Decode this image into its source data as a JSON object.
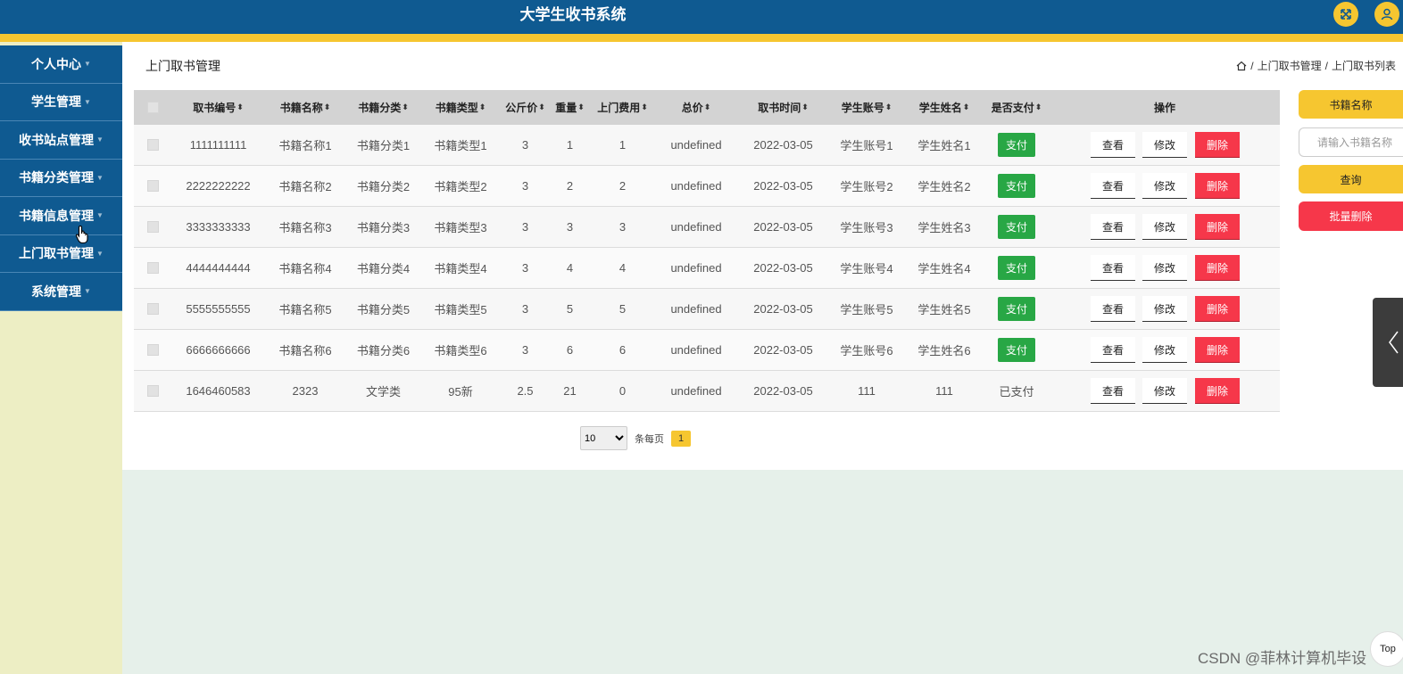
{
  "header": {
    "title": "大学生收书系统",
    "accent": "#f6c630",
    "bg": "#0f5a91"
  },
  "sidebar": {
    "items": [
      {
        "label": "个人中心"
      },
      {
        "label": "学生管理"
      },
      {
        "label": "收书站点管理"
      },
      {
        "label": "书籍分类管理"
      },
      {
        "label": "书籍信息管理"
      },
      {
        "label": "上门取书管理"
      },
      {
        "label": "系统管理"
      }
    ]
  },
  "page": {
    "title": "上门取书管理",
    "breadcrumb": [
      "上门取书管理",
      "上门取书列表"
    ]
  },
  "table": {
    "headers": [
      "取书编号",
      "书籍名称",
      "书籍分类",
      "书籍类型",
      "公斤价",
      "重量",
      "上门费用",
      "总价",
      "取书时间",
      "学生账号",
      "学生姓名",
      "是否支付",
      "操作"
    ],
    "rows": [
      {
        "id": "1111111111",
        "name": "书籍名称1",
        "cat": "书籍分类1",
        "type": "书籍类型1",
        "price": "3",
        "weight": "1",
        "fee": "1",
        "total": "undefined",
        "time": "2022-03-05",
        "account": "学生账号1",
        "student": "学生姓名1",
        "paid": "支付",
        "paid_is_button": true
      },
      {
        "id": "2222222222",
        "name": "书籍名称2",
        "cat": "书籍分类2",
        "type": "书籍类型2",
        "price": "3",
        "weight": "2",
        "fee": "2",
        "total": "undefined",
        "time": "2022-03-05",
        "account": "学生账号2",
        "student": "学生姓名2",
        "paid": "支付",
        "paid_is_button": true
      },
      {
        "id": "3333333333",
        "name": "书籍名称3",
        "cat": "书籍分类3",
        "type": "书籍类型3",
        "price": "3",
        "weight": "3",
        "fee": "3",
        "total": "undefined",
        "time": "2022-03-05",
        "account": "学生账号3",
        "student": "学生姓名3",
        "paid": "支付",
        "paid_is_button": true
      },
      {
        "id": "4444444444",
        "name": "书籍名称4",
        "cat": "书籍分类4",
        "type": "书籍类型4",
        "price": "3",
        "weight": "4",
        "fee": "4",
        "total": "undefined",
        "time": "2022-03-05",
        "account": "学生账号4",
        "student": "学生姓名4",
        "paid": "支付",
        "paid_is_button": true
      },
      {
        "id": "5555555555",
        "name": "书籍名称5",
        "cat": "书籍分类5",
        "type": "书籍类型5",
        "price": "3",
        "weight": "5",
        "fee": "5",
        "total": "undefined",
        "time": "2022-03-05",
        "account": "学生账号5",
        "student": "学生姓名5",
        "paid": "支付",
        "paid_is_button": true
      },
      {
        "id": "6666666666",
        "name": "书籍名称6",
        "cat": "书籍分类6",
        "type": "书籍类型6",
        "price": "3",
        "weight": "6",
        "fee": "6",
        "total": "undefined",
        "time": "2022-03-05",
        "account": "学生账号6",
        "student": "学生姓名6",
        "paid": "支付",
        "paid_is_button": true
      },
      {
        "id": "1646460583",
        "name": "2323",
        "cat": "文学类",
        "type": "95新",
        "price": "2.5",
        "weight": "21",
        "fee": "0",
        "total": "undefined",
        "time": "2022-03-05",
        "account": "111",
        "student": "111",
        "paid": "已支付",
        "paid_is_button": false
      }
    ],
    "actions": {
      "view": "查看",
      "edit": "修改",
      "delete": "删除"
    }
  },
  "pagination": {
    "page_size": "10",
    "per_page_label": "条每页",
    "current_page": "1"
  },
  "search": {
    "label": "书籍名称",
    "placeholder": "请输入书籍名称",
    "query_label": "查询",
    "batch_delete_label": "批量删除"
  },
  "misc": {
    "top_label": "Top",
    "watermark": "CSDN @菲林计算机毕设"
  }
}
